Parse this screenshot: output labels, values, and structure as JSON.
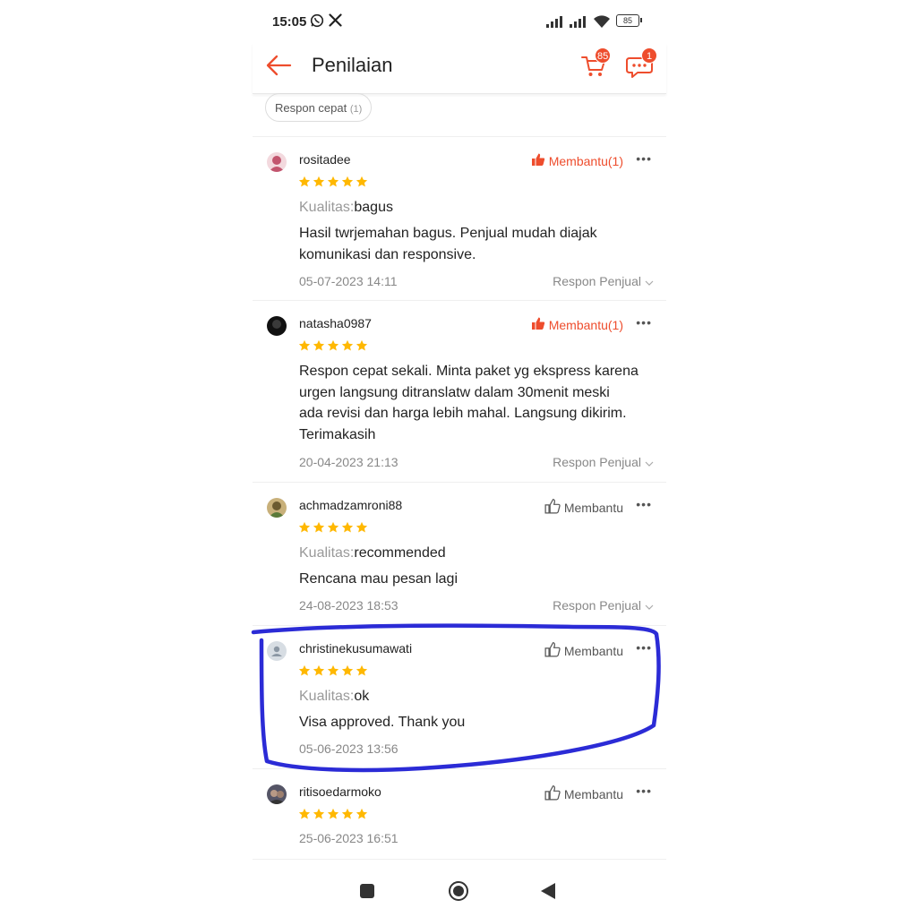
{
  "status_bar": {
    "time": "15:05",
    "battery": "85"
  },
  "header": {
    "title": "Penilaian",
    "cart_badge": "85",
    "chat_badge": "1"
  },
  "filter_chip": {
    "label": "Respon cepat",
    "count": "(1)"
  },
  "colors": {
    "accent": "#ee4d2d",
    "star": "#ffb800",
    "annotation": "#2b2bd6"
  },
  "reviews": [
    {
      "username": "rositadee",
      "helpful_label": "Membantu(1)",
      "stars": 5,
      "quality_label": "Kualitas:",
      "quality_value": "bagus",
      "text_lines": [
        "Hasil twrjemahan bagus. Penjual mudah diajak",
        "komunikasi dan responsive."
      ],
      "date": "05-07-2023 14:11",
      "respon": "Respon Penjual"
    },
    {
      "username": "natasha0987",
      "helpful_label": "Membantu(1)",
      "stars": 5,
      "text_lines": [
        "Respon cepat sekali. Minta paket yg ekspress karena",
        "urgen langsung ditranslatw dalam 30menit meski",
        "ada revisi dan harga lebih mahal. Langsung dikirim.",
        "Terimakasih"
      ],
      "date": "20-04-2023 21:13",
      "respon": "Respon Penjual"
    },
    {
      "username": "achmadzamroni88",
      "helpful_label": "Membantu",
      "stars": 5,
      "quality_label": "Kualitas:",
      "quality_value": "recommended",
      "text_lines": [
        "Rencana mau pesan lagi"
      ],
      "date": "24-08-2023 18:53",
      "respon": "Respon Penjual"
    },
    {
      "username": "christinekusumawati",
      "helpful_label": "Membantu",
      "stars": 5,
      "quality_label": "Kualitas:",
      "quality_value": "ok",
      "text_lines": [
        "Visa approved. Thank you"
      ],
      "date": "05-06-2023 13:56"
    },
    {
      "username": "ritisoedarmoko",
      "helpful_label": "Membantu",
      "stars": 5,
      "date": "25-06-2023 16:51"
    }
  ]
}
